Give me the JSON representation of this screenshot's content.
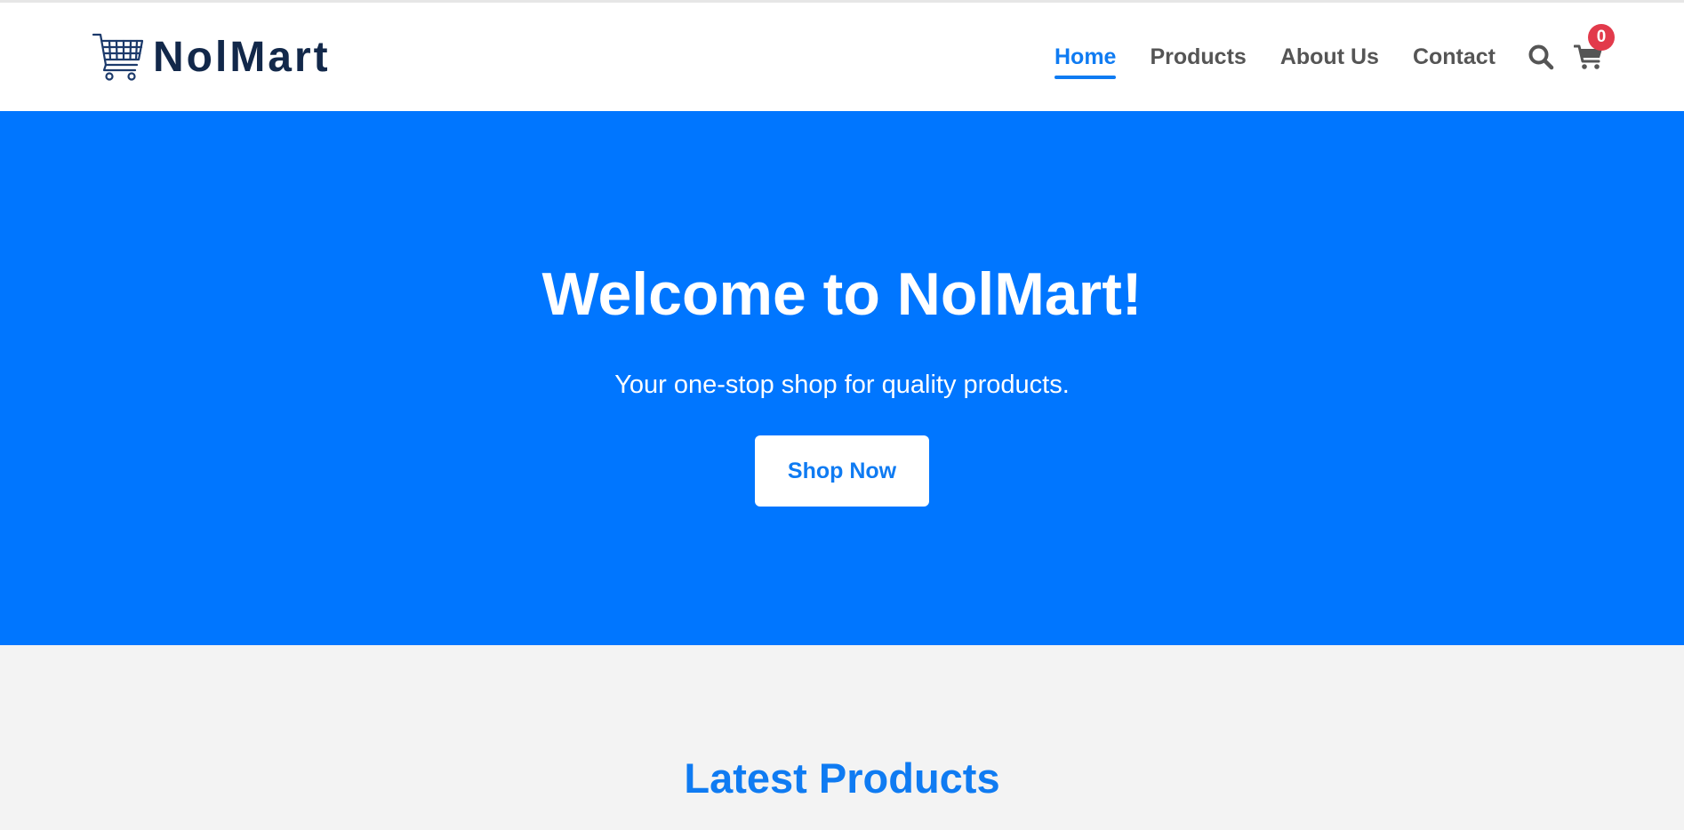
{
  "header": {
    "brand_name": "NolMart",
    "nav": [
      {
        "label": "Home",
        "active": true
      },
      {
        "label": "Products",
        "active": false
      },
      {
        "label": "About Us",
        "active": false
      },
      {
        "label": "Contact",
        "active": false
      }
    ],
    "search_icon": "search-icon",
    "cart_icon": "cart-icon",
    "cart_count": "0"
  },
  "hero": {
    "title": "Welcome to NolMart!",
    "subtitle": "Your one-stop shop for quality products.",
    "cta_label": "Shop Now"
  },
  "latest": {
    "title": "Latest Products"
  },
  "colors": {
    "primary": "#0076ff",
    "accent_text": "#0f7bf2",
    "brand_dark": "#12284a",
    "badge": "#e23a4b",
    "nav_text": "#555555",
    "page_bg": "#f3f3f3"
  }
}
